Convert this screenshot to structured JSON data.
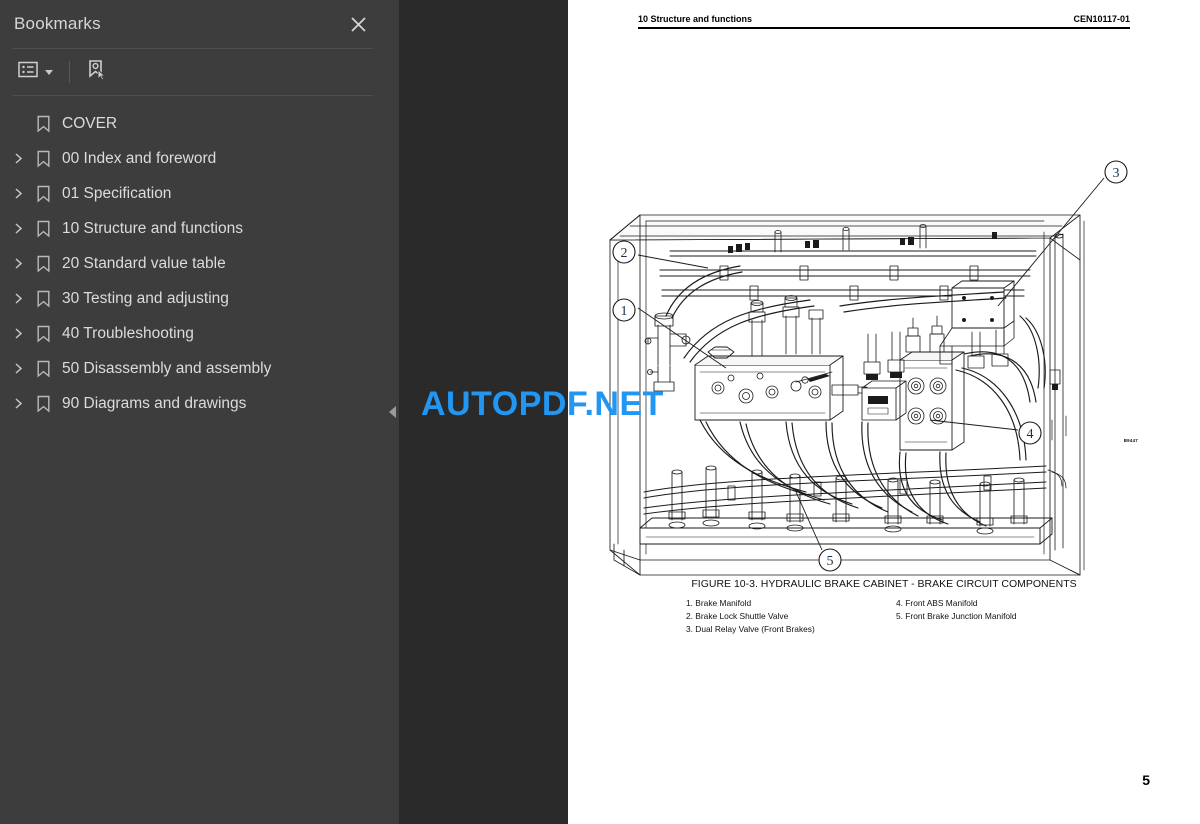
{
  "sidebar": {
    "title": "Bookmarks",
    "close_icon": "close-icon",
    "toolbar": {
      "options_icon": "list-options-icon",
      "caret_icon": "chevron-down-icon",
      "new_bookmark_icon": "bookmark-pointer-icon"
    },
    "items": [
      {
        "label": "COVER",
        "expandable": false
      },
      {
        "label": "00 Index and foreword",
        "expandable": true
      },
      {
        "label": "01 Specification",
        "expandable": true
      },
      {
        "label": "10 Structure and functions",
        "expandable": true
      },
      {
        "label": "20 Standard value table",
        "expandable": true
      },
      {
        "label": "30 Testing and adjusting",
        "expandable": true
      },
      {
        "label": "40 Troubleshooting",
        "expandable": true
      },
      {
        "label": "50 Disassembly and assembly",
        "expandable": true
      },
      {
        "label": "90 Diagrams and drawings",
        "expandable": true
      }
    ]
  },
  "splitter": {
    "collapse_icon": "collapse-left-icon"
  },
  "document": {
    "header_left": "10 Structure and functions",
    "header_right": "CEN10117-01",
    "figure_code": "B9447",
    "caption": "FIGURE 10-3. HYDRAULIC BRAKE CABINET - BRAKE CIRCUIT COMPONENTS",
    "legend_left": [
      "1. Brake Manifold",
      "2. Brake Lock Shuttle Valve",
      "3. Dual Relay Valve (Front Brakes)"
    ],
    "legend_right": [
      "4. Front ABS Manifold",
      "5. Front Brake Junction Manifold"
    ],
    "callouts": [
      "1",
      "2",
      "3",
      "4",
      "5"
    ],
    "page_number": "5"
  },
  "watermark": {
    "text": "AUTOPDF.NET",
    "color": "#2196f3"
  }
}
